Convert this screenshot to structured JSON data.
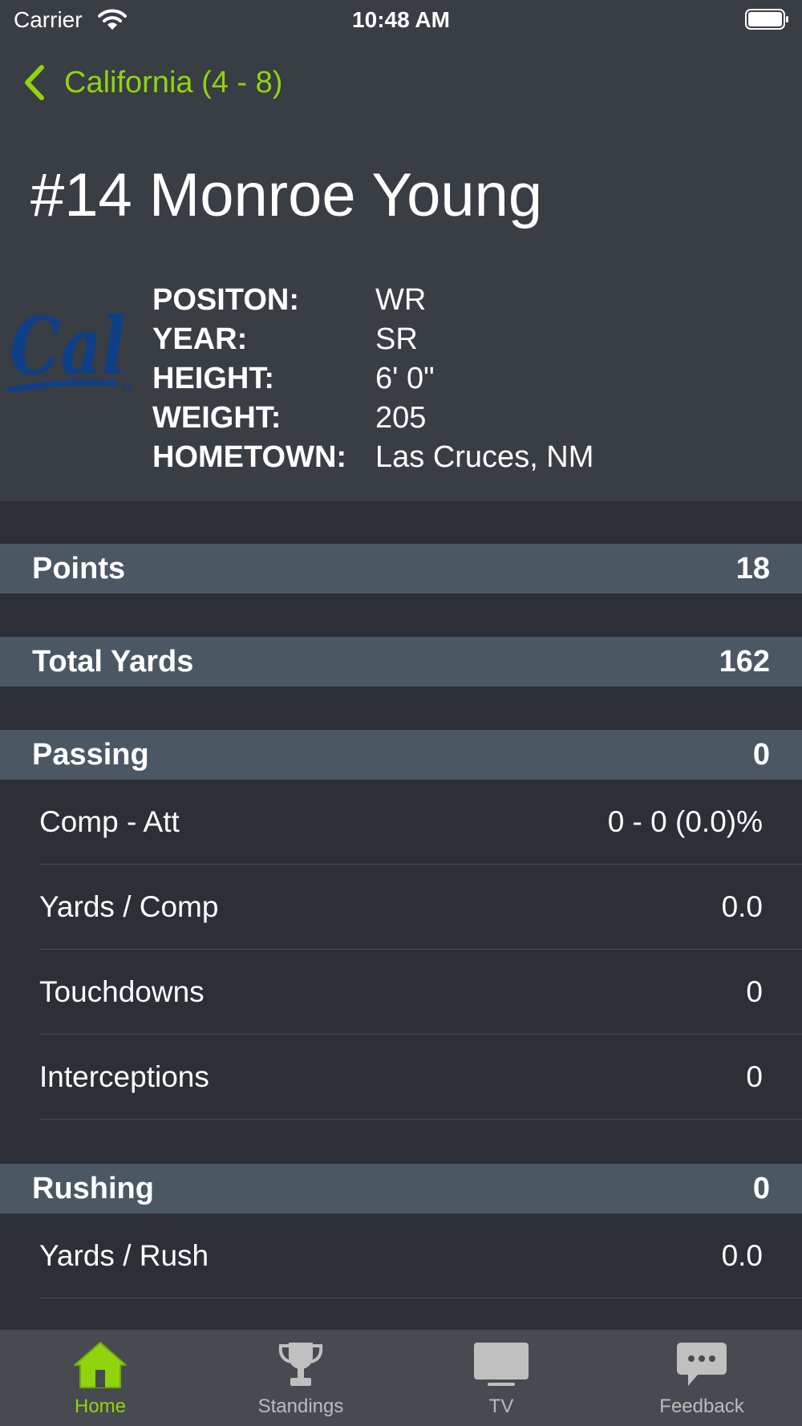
{
  "status_bar": {
    "carrier": "Carrier",
    "time": "10:48 AM"
  },
  "nav": {
    "back_label": "California (4 - 8)"
  },
  "player": {
    "name": "#14 Monroe Young",
    "logo_text": "Cal",
    "info": [
      {
        "key": "POSITON:",
        "value": "WR"
      },
      {
        "key": "YEAR:",
        "value": "SR"
      },
      {
        "key": "HEIGHT:",
        "value": "6' 0\""
      },
      {
        "key": "WEIGHT:",
        "value": "205"
      },
      {
        "key": "HOMETOWN:",
        "value": "Las Cruces, NM"
      }
    ]
  },
  "sections": {
    "points": {
      "label": "Points",
      "value": "18"
    },
    "total_yards": {
      "label": "Total Yards",
      "value": "162"
    },
    "passing": {
      "label": "Passing",
      "value": "0",
      "rows": [
        {
          "label": "Comp - Att",
          "value": "0 - 0 (0.0)%"
        },
        {
          "label": "Yards / Comp",
          "value": "0.0"
        },
        {
          "label": "Touchdowns",
          "value": "0"
        },
        {
          "label": "Interceptions",
          "value": "0"
        }
      ]
    },
    "rushing": {
      "label": "Rushing",
      "value": "0",
      "rows": [
        {
          "label": "Yards / Rush",
          "value": "0.0"
        }
      ]
    }
  },
  "tabbar": {
    "tabs": [
      {
        "label": "Home",
        "icon": "home-icon",
        "active": true
      },
      {
        "label": "Standings",
        "icon": "trophy-icon",
        "active": false
      },
      {
        "label": "TV",
        "icon": "tv-icon",
        "active": false
      },
      {
        "label": "Feedback",
        "icon": "chat-bubble-icon",
        "active": false
      }
    ]
  },
  "colors": {
    "accent": "#8fd40d",
    "header_bg": "#393d44",
    "body_bg": "#2c2f36",
    "section_bg": "#4b5864",
    "tabbar_bg": "#474b51",
    "logo_blue": "#0f3f86"
  }
}
